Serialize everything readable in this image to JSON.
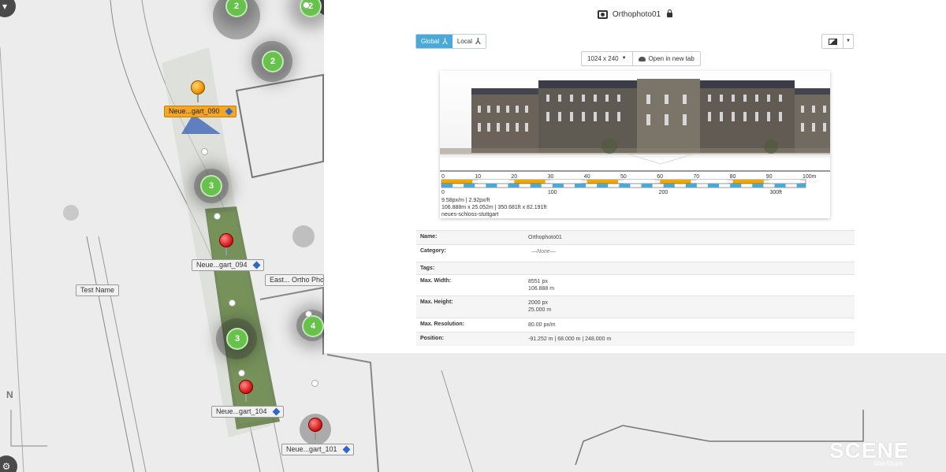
{
  "panel": {
    "title": "Orthophoto01",
    "toggle": {
      "global": "Global",
      "local": "Local"
    },
    "resolution": "1024 x 240",
    "open_tab": "Open in new tab",
    "scale": {
      "metric_ticks": [
        "0",
        "10",
        "20",
        "30",
        "40",
        "50",
        "60",
        "70",
        "80",
        "90",
        "100m"
      ],
      "imperial_ticks": [
        "0",
        "100",
        "200",
        "300ft"
      ]
    },
    "info": {
      "density": "9.58px/m | 2.92px/ft",
      "size": "106.888m x 25.052m | 350.681ft x 82.191ft",
      "project": "neues-schloss-stuttgart"
    },
    "properties": [
      {
        "key": "Name:",
        "values": [
          "Orthophoto01"
        ]
      },
      {
        "key": "Category:",
        "values": [
          "—None—"
        ]
      },
      {
        "key": "Tags:",
        "values": [
          ""
        ]
      },
      {
        "key": "Max. Width:",
        "values": [
          "8551 px",
          "106.888 m"
        ]
      },
      {
        "key": "Max. Height:",
        "values": [
          "2000 px",
          "25.000 m"
        ]
      },
      {
        "key": "Max. Resolution:",
        "values": [
          "80.00 px/m"
        ]
      },
      {
        "key": "Position:",
        "values": [
          "-91.252 m | 68.000 m | 248.000 m"
        ]
      }
    ]
  },
  "map": {
    "clusters": [
      "2",
      "2",
      "2",
      "3",
      "3",
      "4"
    ],
    "markers": [
      {
        "label": "Neue...gart_090",
        "active": true
      },
      {
        "label": "Neue...gart_094",
        "active": false
      },
      {
        "label": "Neue...gart_104",
        "active": false
      },
      {
        "label": "Neue...gart_101",
        "active": false
      }
    ],
    "labels": {
      "test_name": "Test Name",
      "ortho": "East... Ortho Photo"
    },
    "compass": "N",
    "logo": "SCENE",
    "logo_sub": "WebShare"
  },
  "colors": {
    "accent": "#4aa9d8",
    "scale_orange": "#f0a800",
    "scale_blue": "#4aa9d8",
    "cluster": "#66c24a",
    "active_marker": "#f5a623"
  }
}
